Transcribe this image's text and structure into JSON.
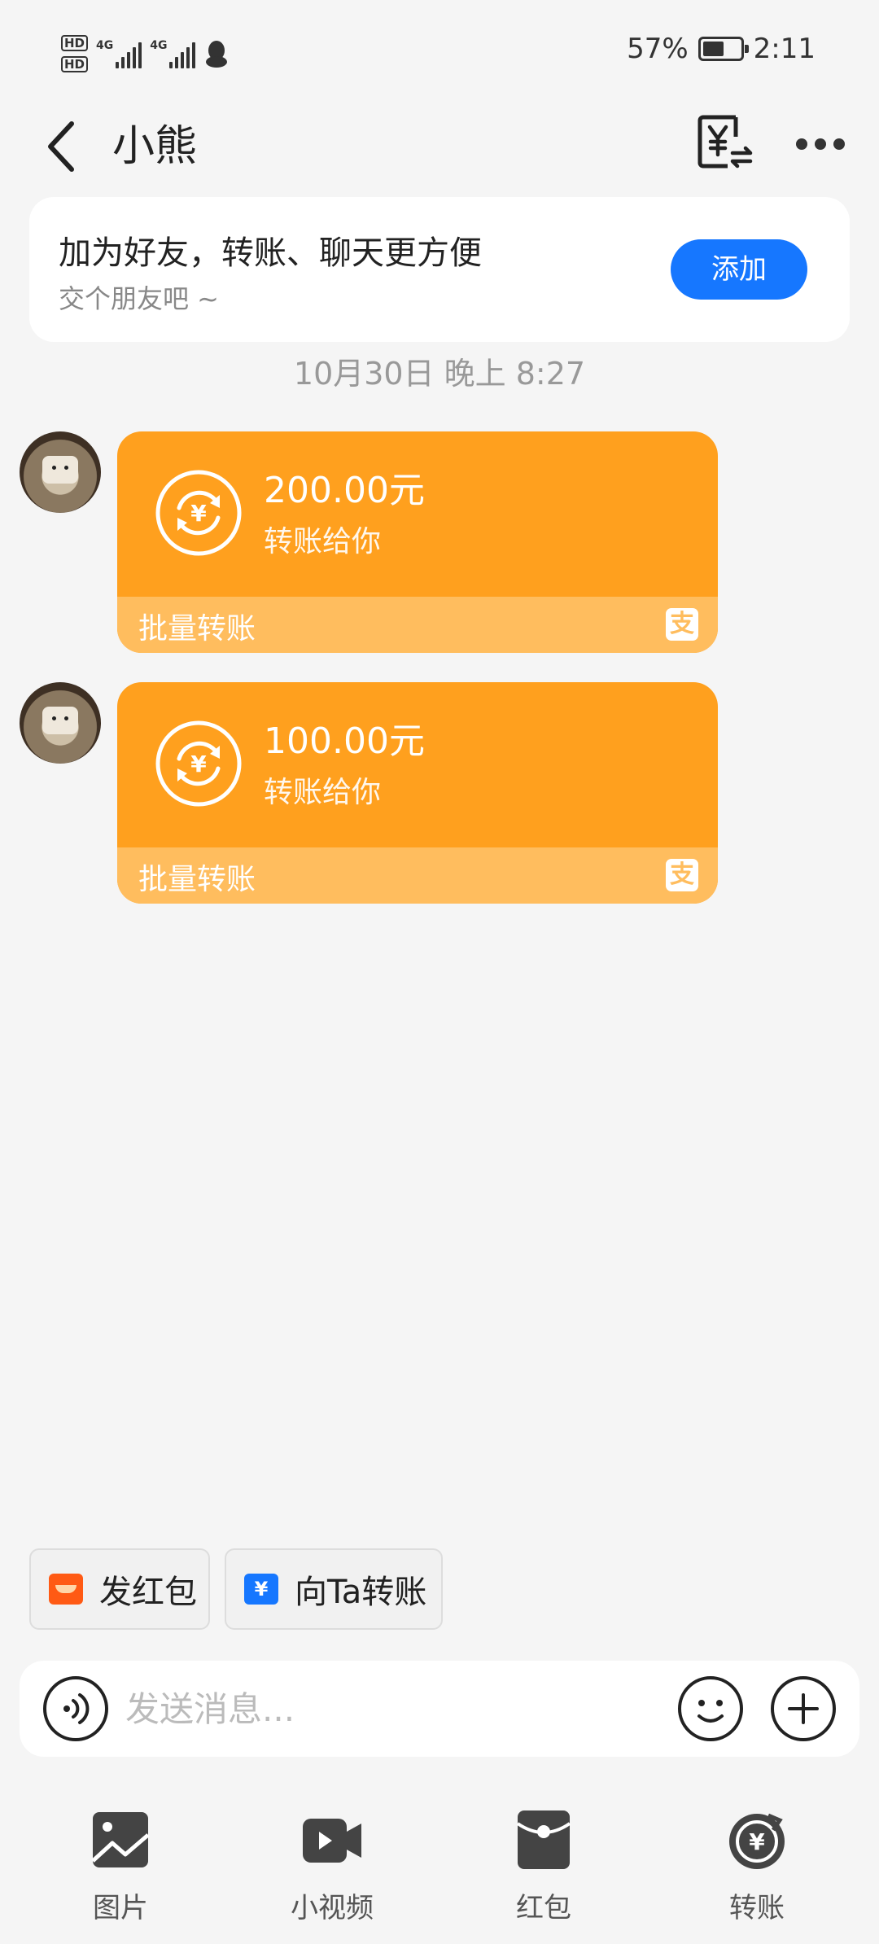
{
  "status_bar": {
    "sim1": "HD",
    "sim2": "HD",
    "net1": "4G",
    "net2": "4G",
    "battery": "57%",
    "battery_level": 0.57,
    "time": "2:11"
  },
  "header": {
    "title": "小熊"
  },
  "banner": {
    "title": "加为好友，转账、聊天更方便",
    "subtitle": "交个朋友吧 ~",
    "add_label": "添加"
  },
  "timestamp": "10月30日 晚上 8:27",
  "messages": [
    {
      "amount": "200.00元",
      "subtitle": "转账给你",
      "footer": "批量转账",
      "brand_icon": "支"
    },
    {
      "amount": "100.00元",
      "subtitle": "转账给你",
      "footer": "批量转账",
      "brand_icon": "支"
    }
  ],
  "quick_actions": [
    {
      "label": "发红包",
      "icon": "red-envelope-icon"
    },
    {
      "label": "向Ta转账",
      "icon": "transfer-icon"
    }
  ],
  "input": {
    "placeholder": "发送消息..."
  },
  "tools": [
    {
      "label": "图片",
      "icon": "image-icon"
    },
    {
      "label": "小视频",
      "icon": "video-icon"
    },
    {
      "label": "红包",
      "icon": "red-envelope-icon"
    },
    {
      "label": "转账",
      "icon": "transfer-icon"
    }
  ],
  "colors": {
    "card": "#ffa01e",
    "card_footer": "#ffbd5e",
    "primary": "#1677ff",
    "red_envelope": "#ff5a14"
  }
}
